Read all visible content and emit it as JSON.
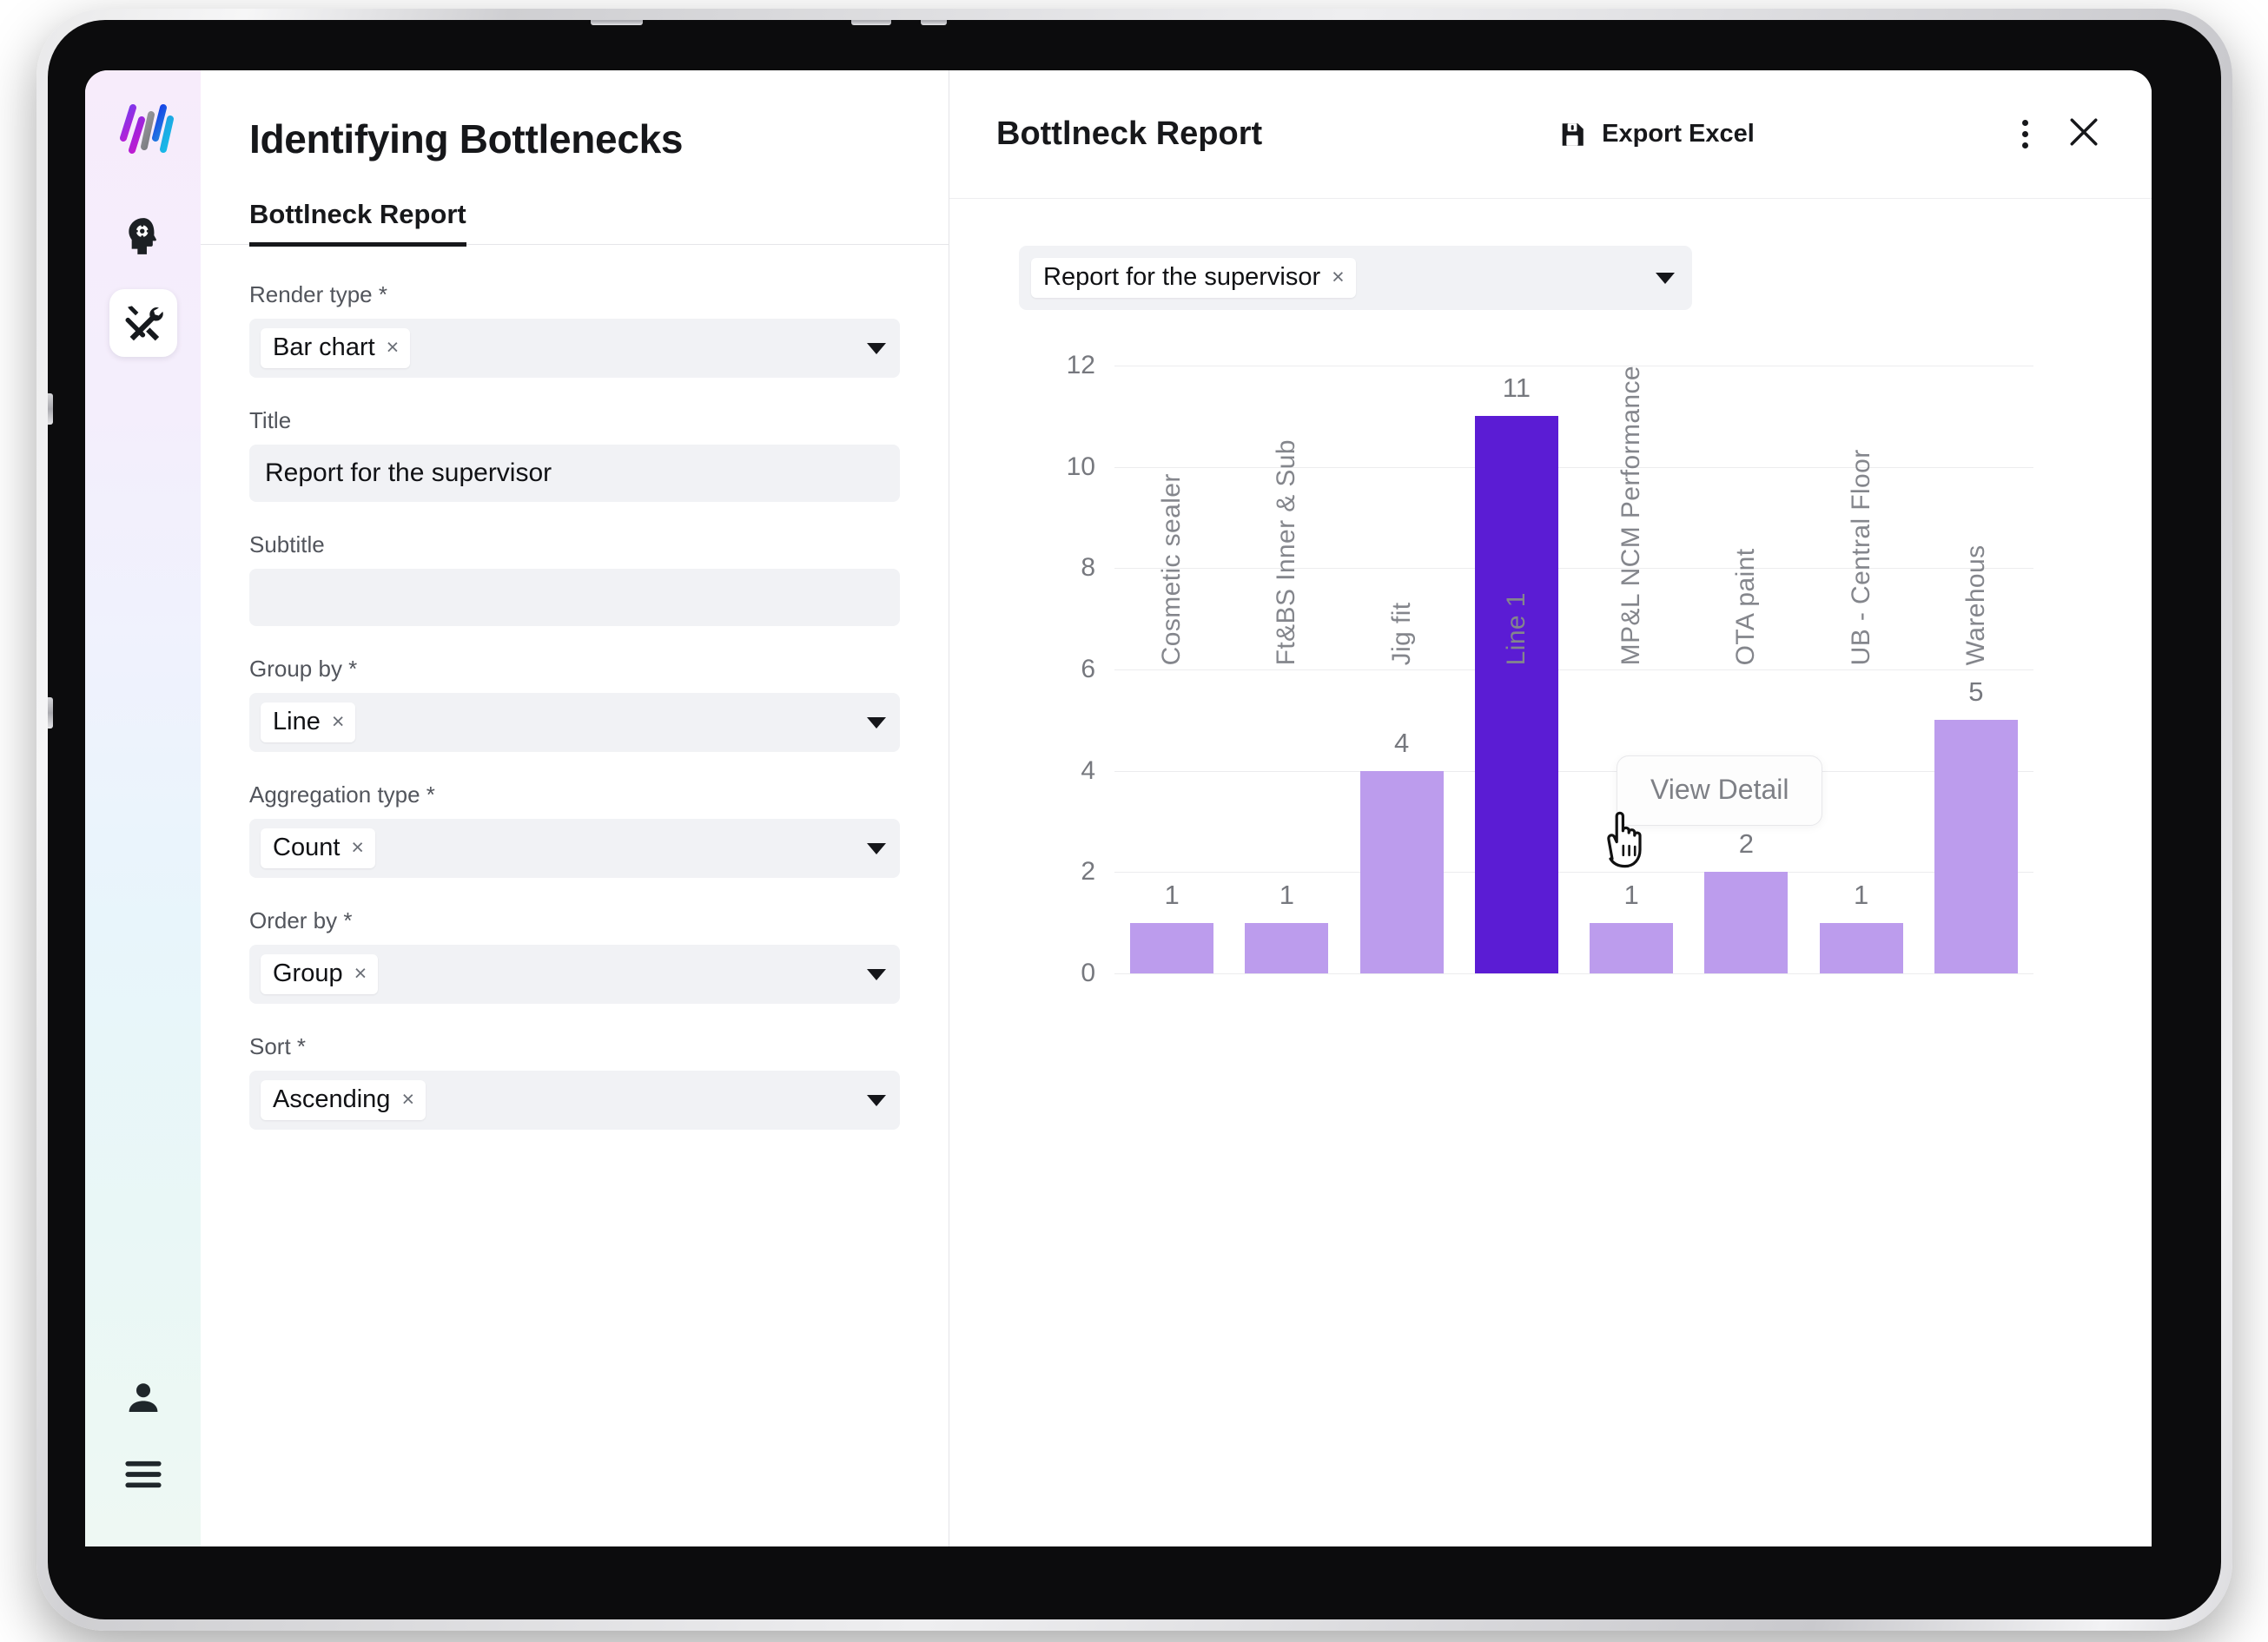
{
  "app": {
    "logo_icon": "brand-bars-logo"
  },
  "rail": {
    "items": [
      {
        "icon": "head-gear-icon",
        "name": "ai-assistant",
        "selected": false
      },
      {
        "icon": "hammer-wrench-icon",
        "name": "tools",
        "selected": true
      }
    ],
    "bottom_items": [
      {
        "icon": "user-icon",
        "name": "account"
      },
      {
        "icon": "hamburger-menu-icon",
        "name": "menu"
      }
    ]
  },
  "left": {
    "page_title": "Identifying Bottlenecks",
    "tabs": [
      {
        "label": "Bottlneck Report",
        "active": true
      }
    ],
    "fields": [
      {
        "label": "Render type *",
        "type": "select",
        "chip": "Bar chart",
        "chip_remove": "×",
        "name": "render-type"
      },
      {
        "label": "Title",
        "type": "text",
        "value": "Report for the supervisor",
        "placeholder": "",
        "name": "title"
      },
      {
        "label": "Subtitle",
        "type": "text",
        "value": "",
        "placeholder": "",
        "name": "subtitle"
      },
      {
        "label": "Group by *",
        "type": "select",
        "chip": "Line",
        "chip_remove": "×",
        "name": "group-by"
      },
      {
        "label": "Aggregation type *",
        "type": "select",
        "chip": "Count",
        "chip_remove": "×",
        "name": "aggregation-type"
      },
      {
        "label": "Order by *",
        "type": "select",
        "chip": "Group",
        "chip_remove": "×",
        "name": "order-by"
      },
      {
        "label": "Sort *",
        "type": "select",
        "chip": "Ascending",
        "chip_remove": "×",
        "name": "sort"
      }
    ]
  },
  "right": {
    "title": "Bottlneck Report",
    "export_label": "Export Excel",
    "export_icon": "save-floppy-icon",
    "more_icon": "kebab-menu-icon",
    "close_icon": "close-x-icon",
    "report_select": {
      "chip": "Report for the supervisor",
      "chip_remove": "×"
    },
    "tooltip": "View Detail",
    "cursor_icon": "pointing-hand-cursor"
  },
  "colors": {
    "bar": "#bc9ced",
    "bar_highlight": "#5b1cd4",
    "axis_text": "#76787e",
    "gridline": "#ececee",
    "panel_bg": "#ffffff",
    "field_bg": "#f1f2f5"
  },
  "chart_data": {
    "type": "bar",
    "title": "Report for the supervisor",
    "subtitle": "",
    "xlabel": "",
    "ylabel": "",
    "ylim": [
      0,
      12
    ],
    "yticks": [
      0,
      2,
      4,
      6,
      8,
      10,
      12
    ],
    "grid": true,
    "legend": "none",
    "categories": [
      "Cosmetic sealer",
      "Ft&BS Inner & Sub",
      "Jig fit",
      "Line 1",
      "MP&L NCM Performance",
      "OTA paint",
      "UB - Central Floor",
      "Warehous"
    ],
    "values": [
      1,
      1,
      4,
      11,
      1,
      2,
      1,
      5
    ],
    "highlight_index": 3
  }
}
